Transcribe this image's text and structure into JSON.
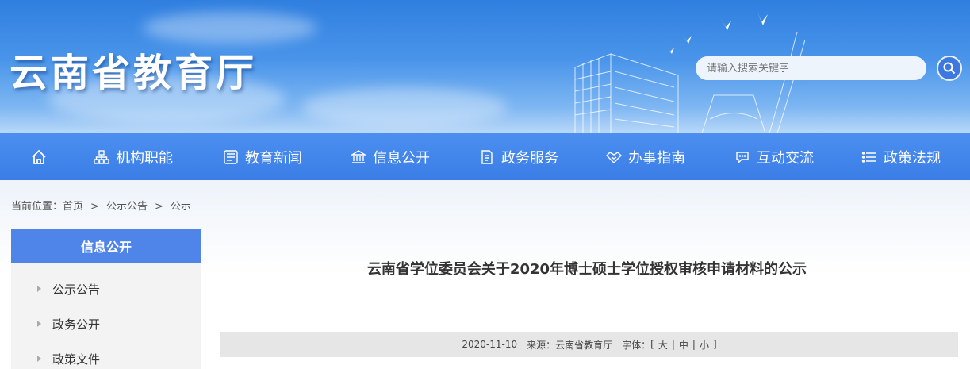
{
  "header": {
    "site_title": "云南省教育厅",
    "search_placeholder": "请输入搜索关键字"
  },
  "nav": {
    "items": [
      {
        "label": "机构职能",
        "icon": "org-chart-icon"
      },
      {
        "label": "教育新闻",
        "icon": "news-icon"
      },
      {
        "label": "信息公开",
        "icon": "building-icon"
      },
      {
        "label": "政务服务",
        "icon": "document-icon"
      },
      {
        "label": "办事指南",
        "icon": "handshake-icon"
      },
      {
        "label": "互动交流",
        "icon": "chat-icon"
      },
      {
        "label": "政策法规",
        "icon": "list-icon"
      }
    ]
  },
  "breadcrumb": {
    "prefix": "当前位置：",
    "items": [
      "首页",
      "公示公告",
      "公示"
    ],
    "separator": ">"
  },
  "sidebar": {
    "title": "信息公开",
    "items": [
      {
        "label": "公示公告"
      },
      {
        "label": "政务公开"
      },
      {
        "label": "政策文件"
      }
    ]
  },
  "article": {
    "title": "云南省学位委员会关于2020年博士硕士学位授权审核申请材料的公示",
    "date": "2020-11-10",
    "source_label": "来源：",
    "source": "云南省教育厅",
    "font_label": "字体：",
    "font_open": "[",
    "font_close": "]",
    "font_sep": "|",
    "font_large": "大",
    "font_medium": "中",
    "font_small": "小"
  },
  "colors": {
    "nav_bg": "#3f83ea",
    "sidebar_head": "#4f84e8",
    "search_button": "#3c78e0"
  }
}
